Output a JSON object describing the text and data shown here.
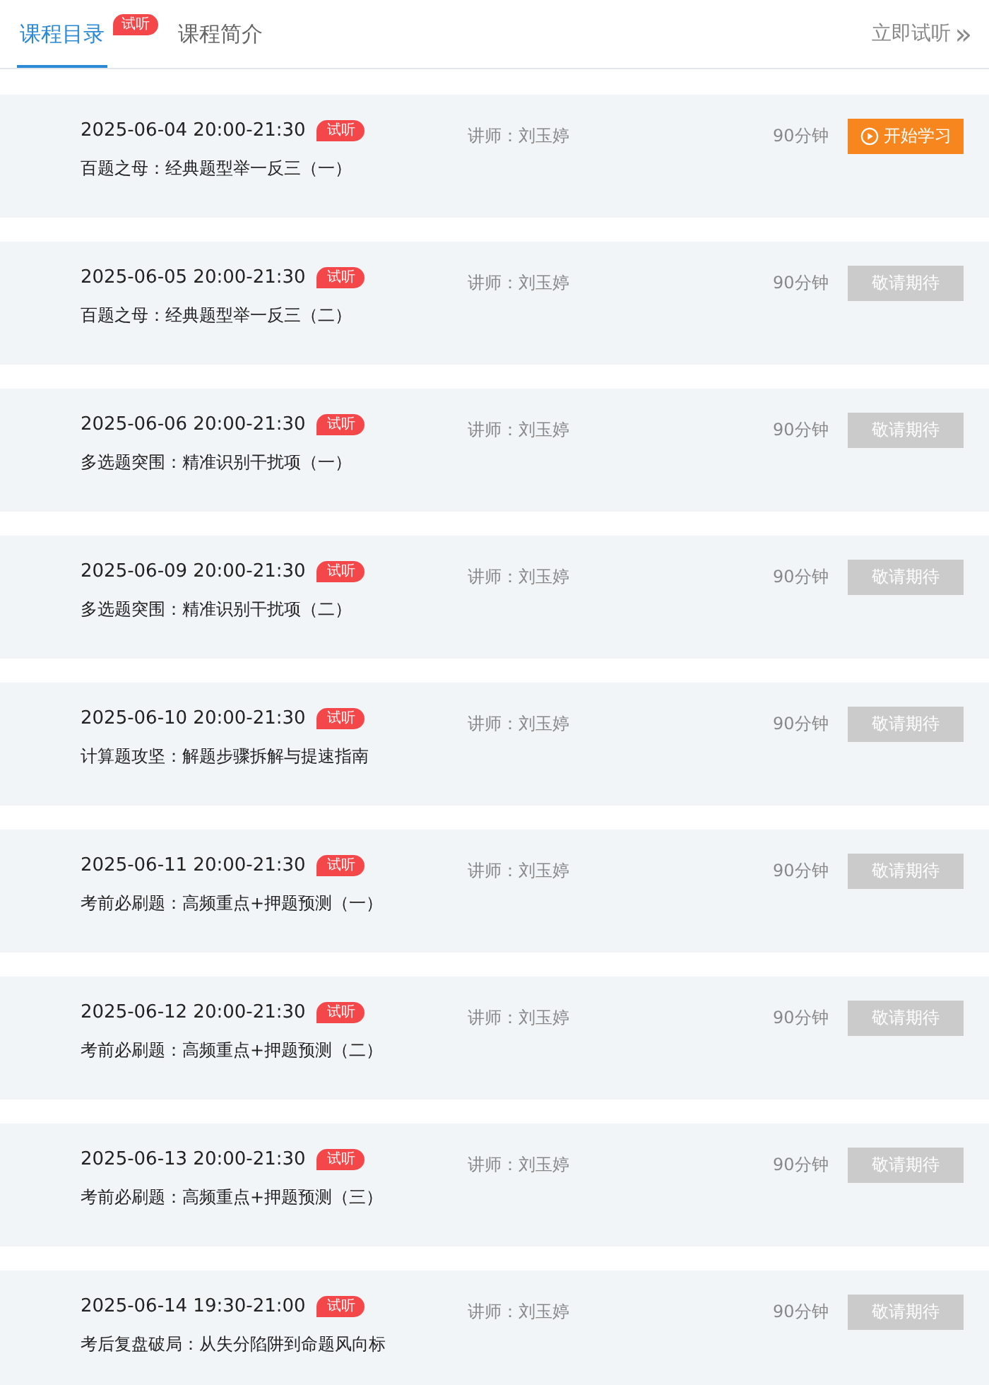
{
  "tabs": [
    {
      "label": "课程目录",
      "selected": true,
      "badge": "试听"
    },
    {
      "label": "课程简介",
      "selected": false
    }
  ],
  "header_link": {
    "label": "立即试听",
    "icon": "»"
  },
  "lessons": [
    {
      "time": "2025-06-04 20:00-21:30",
      "badge": "试听",
      "title": "百题之母：经典题型举一反三（一）",
      "teacher": "讲师：刘玉婷",
      "duration": "90分钟",
      "button": {
        "kind": "start",
        "label": "开始学习"
      }
    },
    {
      "time": "2025-06-05 20:00-21:30",
      "badge": "试听",
      "title": "百题之母：经典题型举一反三（二）",
      "teacher": "讲师：刘玉婷",
      "duration": "90分钟",
      "button": {
        "kind": "pending",
        "label": "敬请期待"
      }
    },
    {
      "time": "2025-06-06 20:00-21:30",
      "badge": "试听",
      "title": "多选题突围：精准识别干扰项（一）",
      "teacher": "讲师：刘玉婷",
      "duration": "90分钟",
      "button": {
        "kind": "pending",
        "label": "敬请期待"
      }
    },
    {
      "time": "2025-06-09 20:00-21:30",
      "badge": "试听",
      "title": "多选题突围：精准识别干扰项（二）",
      "teacher": "讲师：刘玉婷",
      "duration": "90分钟",
      "button": {
        "kind": "pending",
        "label": "敬请期待"
      }
    },
    {
      "time": "2025-06-10 20:00-21:30",
      "badge": "试听",
      "title": "计算题攻坚：解题步骤拆解与提速指南",
      "teacher": "讲师：刘玉婷",
      "duration": "90分钟",
      "button": {
        "kind": "pending",
        "label": "敬请期待"
      }
    },
    {
      "time": "2025-06-11 20:00-21:30",
      "badge": "试听",
      "title": "考前必刷题：高频重点+押题预测（一）",
      "teacher": "讲师：刘玉婷",
      "duration": "90分钟",
      "button": {
        "kind": "pending",
        "label": "敬请期待"
      }
    },
    {
      "time": "2025-06-12 20:00-21:30",
      "badge": "试听",
      "title": "考前必刷题：高频重点+押题预测（二）",
      "teacher": "讲师：刘玉婷",
      "duration": "90分钟",
      "button": {
        "kind": "pending",
        "label": "敬请期待"
      }
    },
    {
      "time": "2025-06-13 20:00-21:30",
      "badge": "试听",
      "title": "考前必刷题：高频重点+押题预测（三）",
      "teacher": "讲师：刘玉婷",
      "duration": "90分钟",
      "button": {
        "kind": "pending",
        "label": "敬请期待"
      }
    },
    {
      "time": "2025-06-14 19:30-21:00",
      "badge": "试听",
      "title": "考后复盘破局：从失分陷阱到命题风向标",
      "teacher": "讲师：刘玉婷",
      "duration": "90分钟",
      "button": {
        "kind": "pending",
        "label": "敬请期待"
      }
    }
  ]
}
